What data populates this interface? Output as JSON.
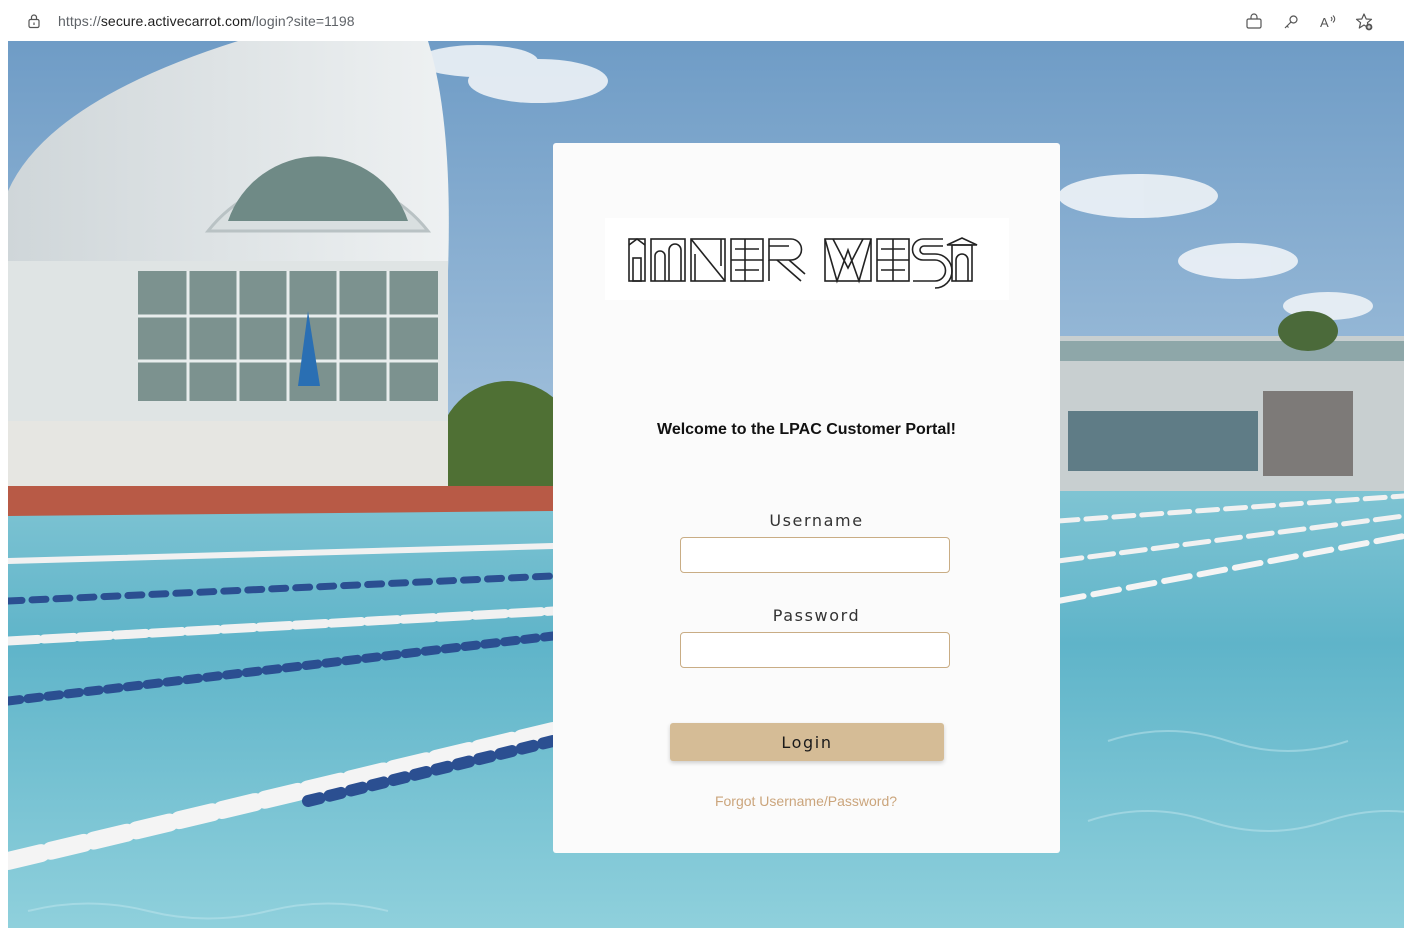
{
  "browser": {
    "url_prefix": "https://",
    "url_host": "secure.activecarrot.com",
    "url_path": "/login?site=1198",
    "toolbar_icons": [
      "bag-icon",
      "key-icon",
      "read-aloud-icon",
      "favorite-add-icon"
    ]
  },
  "card": {
    "welcome": "Welcome to the LPAC Customer Portal!",
    "username_label": "Username",
    "username_value": "",
    "password_label": "Password",
    "password_value": "",
    "login_label": "Login",
    "forgot_link": "Forgot Username/Password?"
  },
  "colors": {
    "accent_tan": "#d5bc96",
    "input_border": "#c9ad85",
    "link": "#cba57c",
    "card_bg": "#fbfbfb"
  }
}
